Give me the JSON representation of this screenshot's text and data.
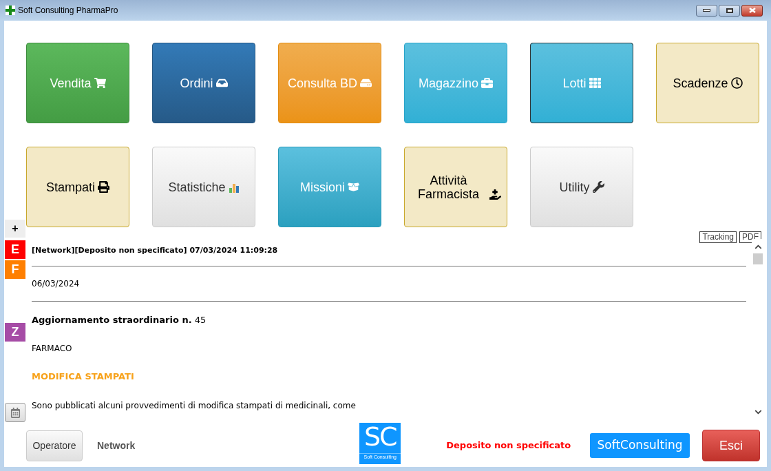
{
  "window": {
    "title": "Soft Consulting PharmaPro"
  },
  "tiles": [
    {
      "label": "Vendita",
      "kind": "green",
      "focused": false
    },
    {
      "label": "Ordini",
      "kind": "navy",
      "focused": false
    },
    {
      "label": "Consulta BD",
      "kind": "orange",
      "focused": false
    },
    {
      "label": "Magazzino",
      "kind": "cyan",
      "focused": false
    },
    {
      "label": "Lotti",
      "kind": "cyan",
      "focused": true
    },
    {
      "label": "Scadenze",
      "kind": "beige",
      "focused": false
    },
    {
      "label": "Stampati",
      "kind": "beige",
      "focused": false
    },
    {
      "label": "Statistiche",
      "kind": "gray",
      "focused": false
    },
    {
      "label": "Missioni",
      "kind": "teal",
      "focused": false
    },
    {
      "label": "Attività Farmacista",
      "kind": "beige",
      "focused": false
    },
    {
      "label": "Utility",
      "kind": "gray",
      "focused": false
    }
  ],
  "side_buttons": {
    "add": "+",
    "letters": [
      {
        "label": "E",
        "color": "#ff0000"
      },
      {
        "label": "F",
        "color": "#ff7f00"
      },
      {
        "label": "Z",
        "color": "#a64ca6"
      }
    ]
  },
  "export_links": [
    "Tracking",
    "PDF"
  ],
  "news": {
    "header": "[Network][Deposito non specificato] 07/03/2024 11:09:28",
    "date": "06/03/2024",
    "title": "**Aggiornamento straordinario n.** 45",
    "category": "FARMACO",
    "subject": "MODIFICA STAMPATI",
    "body": "Sono pubblicati alcuni provvedimenti di modifica stampati di medicinali, come"
  },
  "footer": {
    "operator_button": "Operatore",
    "operator": "Network",
    "logo": {
      "letters": "SC",
      "caption": "Soft Consulting"
    },
    "deposit": "Deposito non specificato",
    "brand_button": "SoftConsulting",
    "exit_button": "Esci"
  }
}
